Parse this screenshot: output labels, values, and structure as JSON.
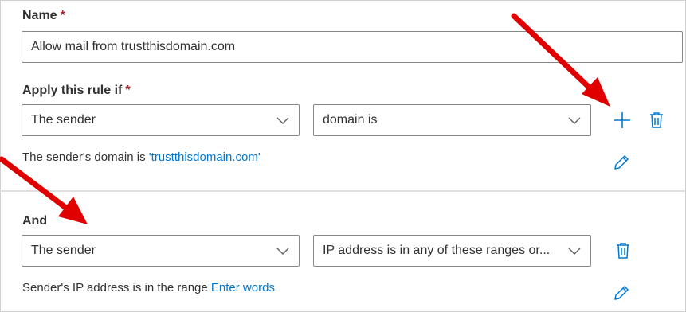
{
  "name_section": {
    "label": "Name",
    "required_mark": "*",
    "value": "Allow mail from trustthisdomain.com"
  },
  "condition1": {
    "label": "Apply this rule if",
    "required_mark": "*",
    "subject_value": "The sender",
    "predicate_value": "domain is",
    "description_prefix": "The sender's domain is",
    "description_link": "'trustthisdomain.com'",
    "add_icon": "plus-icon",
    "delete_icon": "trash-icon",
    "edit_icon": "pencil-icon"
  },
  "condition2": {
    "label": "And",
    "subject_value": "The sender",
    "predicate_value": "IP address is in any of these ranges or...",
    "description_prefix": "Sender's IP address is in the range",
    "description_link": "Enter words",
    "delete_icon": "trash-icon",
    "edit_icon": "pencil-icon"
  },
  "colors": {
    "accent": "#0078d4",
    "required": "#a4262c",
    "annotation_arrow": "#e00000"
  }
}
